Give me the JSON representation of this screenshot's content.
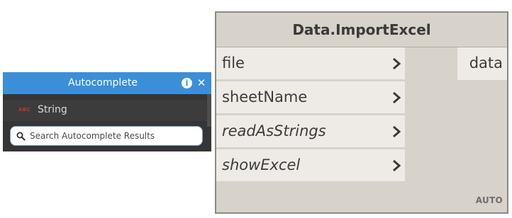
{
  "autocomplete": {
    "title": "Autocomplete",
    "info_glyph": "i",
    "close_glyph": "✕",
    "result": {
      "type_tag": "ABC",
      "label": "String"
    },
    "search": {
      "value": "",
      "placeholder": "Search Autocomplete Results"
    },
    "colors": {
      "header": "#3b8fd8",
      "panel": "#353535"
    }
  },
  "node": {
    "title": "Data.ImportExcel",
    "inputs": [
      {
        "label": "file"
      },
      {
        "label": "sheetName"
      },
      {
        "label": "readAsStrings"
      },
      {
        "label": "showExcel"
      }
    ],
    "output": {
      "label": "data"
    },
    "lacing": "AUTO",
    "colors": {
      "body": "#d7d2ca",
      "port": "#eeebe6"
    }
  }
}
